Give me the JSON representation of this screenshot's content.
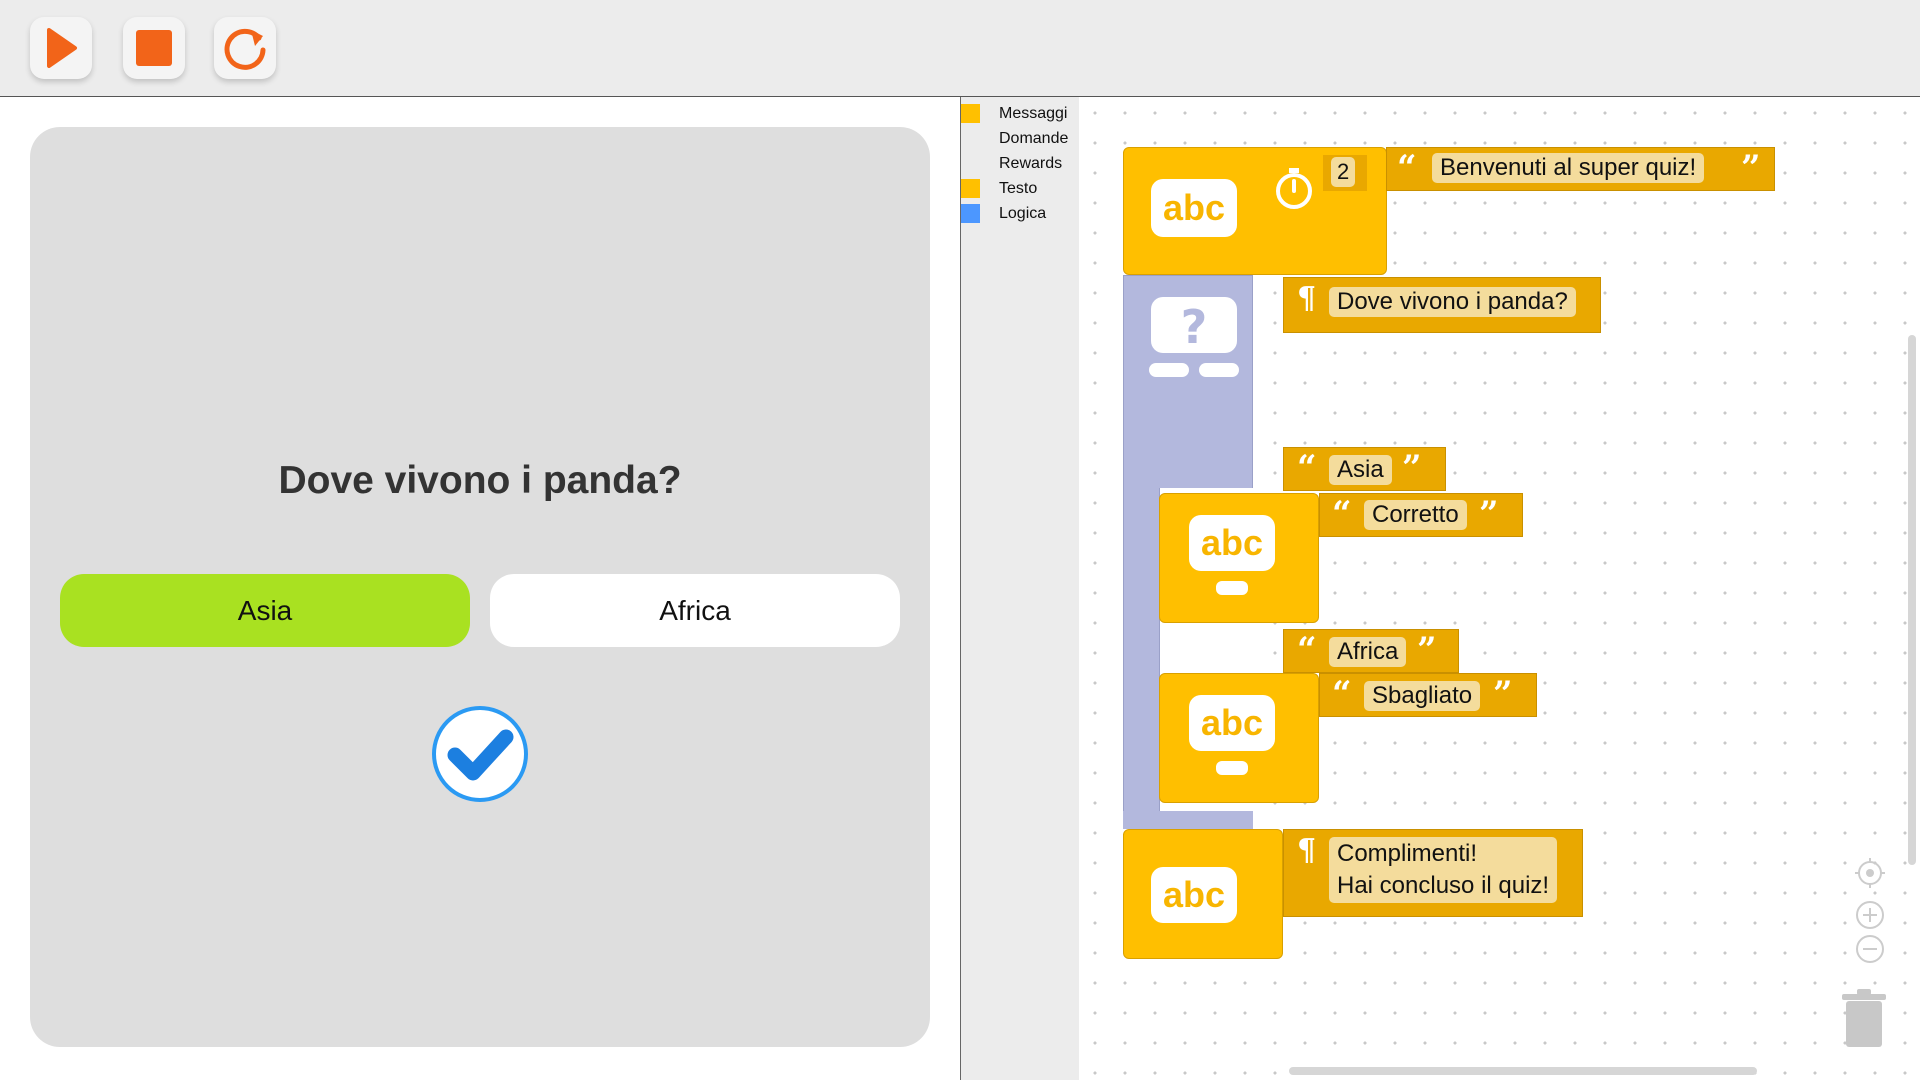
{
  "toolbar": {
    "buttons": [
      {
        "name": "play-icon",
        "color": "#f26419"
      },
      {
        "name": "stop-icon",
        "color": "#f26419"
      },
      {
        "name": "refresh-icon",
        "color": "#f26419"
      }
    ]
  },
  "stage": {
    "question": "Dove vivono i panda?",
    "answers": [
      {
        "label": "Asia",
        "selected": true,
        "color": "#a9e121"
      },
      {
        "label": "Africa",
        "selected": false,
        "color": "#ffffff"
      }
    ],
    "confirm_icon": "check-circle-icon"
  },
  "categories": [
    {
      "label": "Messaggi",
      "color": "#ffc000"
    },
    {
      "label": "Domande",
      "color": ""
    },
    {
      "label": "Rewards",
      "color": ""
    },
    {
      "label": "Testo",
      "color": "#ffc000"
    },
    {
      "label": "Logica",
      "color": "#4c97ff"
    }
  ],
  "workspace": {
    "welcome_block": {
      "icon_label": "abc",
      "timer_icon": "stopwatch-icon",
      "delay_value": "2",
      "text": "Benvenuti al super quiz!"
    },
    "question_block": {
      "icon": "question-screen-icon",
      "question_text": "Dove vivono i panda?",
      "option1": "Asia",
      "option1_msg_icon": "abc",
      "option1_response": "Corretto",
      "option2": "Africa",
      "option2_msg_icon": "abc",
      "option2_response": "Sbagliato"
    },
    "final_block": {
      "icon_label": "abc",
      "line1": "Complimenti!",
      "line2": "Hai concluso il quiz!"
    },
    "quote_open": "“",
    "quote_close": "”",
    "para_mark": "¶",
    "colors": {
      "text_block": "#ffbf00",
      "question_block": "#b3b8dd",
      "field": "#e9a800",
      "field_text_bg": "#f4dc9c"
    }
  },
  "controls": {
    "recenter_icon": "target-icon",
    "zoom_in_icon": "zoom-in-icon",
    "zoom_out_icon": "zoom-out-icon",
    "trash_icon": "trash-icon"
  }
}
